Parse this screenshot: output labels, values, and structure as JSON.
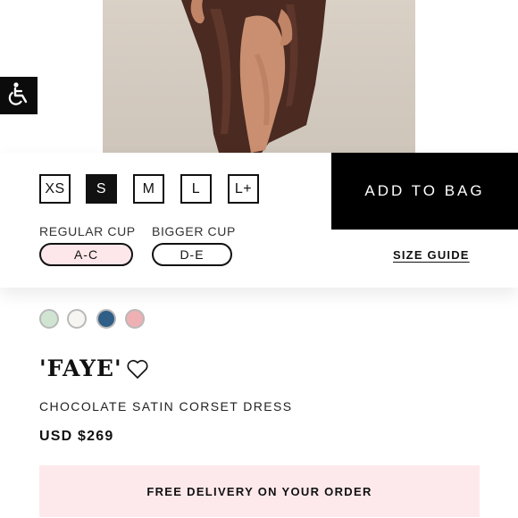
{
  "sizes": {
    "options": [
      "XS",
      "S",
      "M",
      "L",
      "L+"
    ],
    "selected": "S"
  },
  "cart": {
    "add_label": "ADD TO BAG"
  },
  "cups": {
    "regular_label": "REGULAR CUP",
    "regular_value": "A-C",
    "bigger_label": "BIGGER CUP",
    "bigger_value": "D-E",
    "selected": "A-C"
  },
  "size_guide_label": "SIZE GUIDE",
  "swatches": [
    {
      "name": "sage",
      "color": "#cfe5d2"
    },
    {
      "name": "ivory",
      "color": "#f7f5f1"
    },
    {
      "name": "blue",
      "color": "#2f5e86"
    },
    {
      "name": "pink",
      "color": "#efb0b4"
    }
  ],
  "product": {
    "title": "'FAYE'",
    "subtitle": "CHOCOLATE SATIN CORSET DRESS",
    "price": "USD $269"
  },
  "delivery_banner": "FREE DELIVERY ON YOUR ORDER",
  "icons": {
    "accessibility": "wheelchair-icon",
    "wishlist": "heart-outline-icon"
  },
  "colors": {
    "accent": "#000000",
    "selected_cup_bg": "#fde7ea",
    "banner_bg": "#fde9ec"
  }
}
